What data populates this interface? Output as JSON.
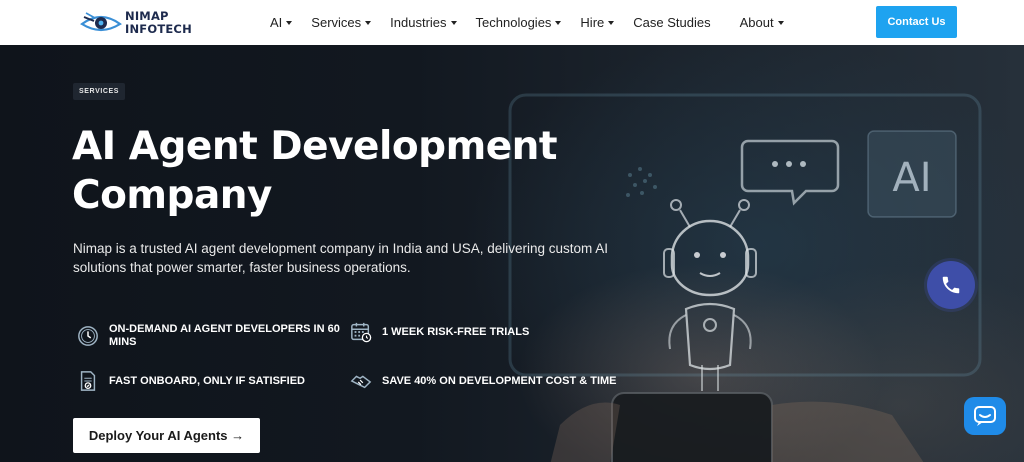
{
  "header": {
    "logo": {
      "line1": "NIMAP",
      "line2": "INFOTECH",
      "icon": "eye-logo-icon"
    },
    "nav": [
      {
        "label": "AI",
        "dropdown": true
      },
      {
        "label": "Services",
        "dropdown": true
      },
      {
        "label": "Industries",
        "dropdown": true
      },
      {
        "label": "Technologies",
        "dropdown": true
      },
      {
        "label": "Hire",
        "dropdown": true
      },
      {
        "label": "Case Studies",
        "dropdown": false
      },
      {
        "label": "About",
        "dropdown": true
      }
    ],
    "contact_label": "Contact Us"
  },
  "hero": {
    "badge": "SERVICES",
    "title_line1": "AI Agent Development",
    "title_line2": "Company",
    "description": "Nimap is a trusted AI agent development company in India and USA, delivering custom AI solutions that power smarter, faster business operations.",
    "features": [
      {
        "label": "ON-DEMAND AI AGENT DEVELOPERS IN 60 MINS",
        "icon": "clock-icon"
      },
      {
        "label": "1 WEEK RISK-FREE TRIALS",
        "icon": "calendar-icon"
      },
      {
        "label": "FAST ONBOARD, ONLY IF SATISFIED",
        "icon": "document-check-icon"
      },
      {
        "label": "SAVE 40% ON DEVELOPMENT COST & TIME",
        "icon": "handshake-icon"
      }
    ],
    "cta_label": "Deploy Your AI Agents →",
    "art_text": "AI"
  },
  "floating": {
    "phone_icon": "phone-icon",
    "chat_icon": "chat-icon"
  },
  "colors": {
    "accent": "#1ea3f0",
    "phone_button": "#3e4ea8",
    "chat_button": "#1f8be8",
    "hero_bg": "#121820"
  }
}
